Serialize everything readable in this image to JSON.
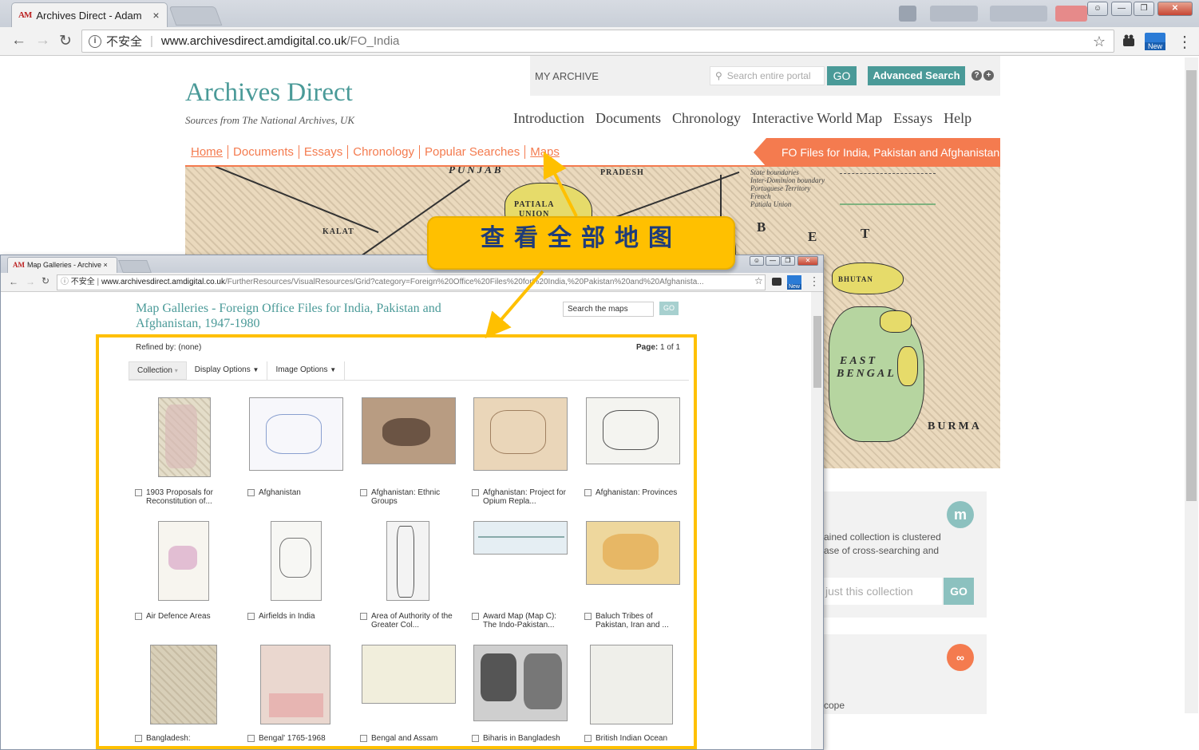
{
  "main_browser": {
    "tab_favicon": "AM",
    "tab_title": "Archives Direct - Adam",
    "tab_close": "×",
    "security_label": "不安全",
    "url_host": "www.archivesdirect.amdigital.co.uk",
    "url_path": "/FO_India",
    "new_badge": "New"
  },
  "site": {
    "my_archive": "MY ARCHIVE",
    "search_placeholder": "Search entire portal",
    "go_label": "GO",
    "advanced_search": "Advanced Search",
    "logo_title": "Archives Direct",
    "logo_subtitle": "Sources from The National Archives, UK",
    "main_nav": [
      "Introduction",
      "Documents",
      "Chronology",
      "Interactive World Map",
      "Essays",
      "Help"
    ],
    "breadcrumb": [
      "Home",
      "Documents",
      "Essays",
      "Chronology",
      "Popular Searches",
      "Maps"
    ],
    "collection_title": "FO Files for India, Pakistan and Afghanistan"
  },
  "background_map": {
    "labels": [
      "PUNJAB",
      "PRADESH",
      "PATIALA",
      "UNION",
      "KALAT",
      "BHUTAN",
      "EAST",
      "BENGAL",
      "BURMA",
      "B",
      "E",
      "T"
    ],
    "legend": [
      "State boundaries",
      "Inter-Dominion boundary",
      "Portuguese Territory",
      "French",
      "Patiala Union"
    ]
  },
  "side_panels": {
    "panel1_text_line1": "ained collection is clustered",
    "panel1_text_line2": "ase of cross-searching and",
    "panel1_search_placeholder": "just this collection",
    "panel1_go": "GO",
    "panel1_icon": "m",
    "panel2_text": "cope",
    "panel2_icon": "link-icon"
  },
  "callout": {
    "text": "查看全部地图",
    "color": "#ffc000"
  },
  "popup_browser": {
    "tab_favicon": "AM",
    "tab_title": "Map Galleries - Archive",
    "security_label": "不安全",
    "url_host": "www.archivesdirect.amdigital.co.uk",
    "url_path": "/FurtherResources/VisualResources/Grid?category=Foreign%20Office%20Files%20for%20India,%20Pakistan%20and%20Afghanista...",
    "new_badge": "New"
  },
  "gallery": {
    "title": "Map Galleries - Foreign Office Files for India, Pakistan and Afghanistan, 1947-1980",
    "search_placeholder": "Search the maps",
    "go_label": "GO",
    "refined_by": "Refined by: (none)",
    "page_label": "Page:",
    "page_value": "1 of 1",
    "toolbar": [
      "Collection",
      "Display Options",
      "Image Options"
    ],
    "items": [
      {
        "caption": "1903 Proposals for Reconstitution of..."
      },
      {
        "caption": "Afghanistan"
      },
      {
        "caption": "Afghanistan: Ethnic Groups"
      },
      {
        "caption": "Afghanistan: Project for Opium Repla..."
      },
      {
        "caption": "Afghanistan: Provinces"
      },
      {
        "caption": "Air Defence Areas"
      },
      {
        "caption": "Airfields in India"
      },
      {
        "caption": "Area of Authority of the Greater Col..."
      },
      {
        "caption": "Award Map (Map C): The Indo-Pakistan..."
      },
      {
        "caption": "Baluch Tribes of Pakistan, Iran and ..."
      },
      {
        "caption": "Bangladesh:"
      },
      {
        "caption": "Bengal' 1765-1968"
      },
      {
        "caption": "Bengal and Assam"
      },
      {
        "caption": "Biharis in Bangladesh"
      },
      {
        "caption": "British Indian Ocean"
      }
    ]
  }
}
